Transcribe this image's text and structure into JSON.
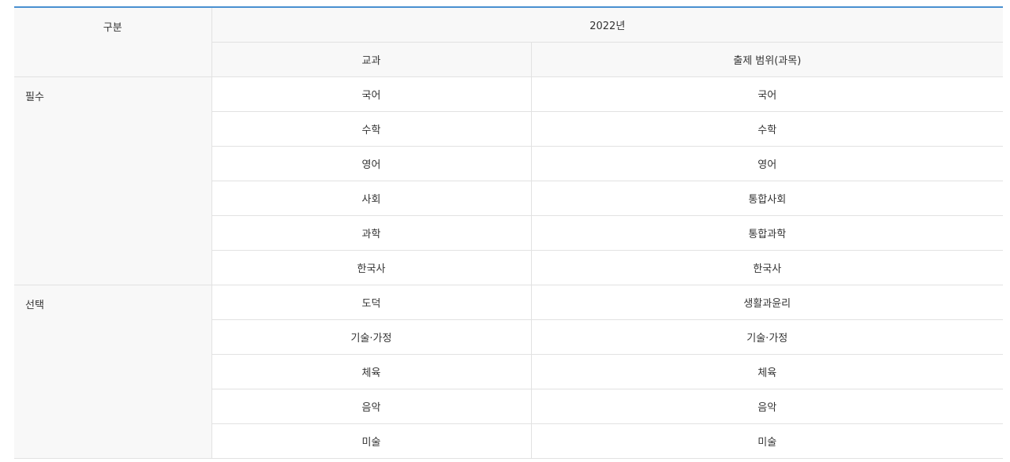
{
  "header": {
    "category_label": "구분",
    "year_label": "2022년",
    "subject_label": "교과",
    "scope_label": "출제 범위(과목)"
  },
  "groups": [
    {
      "name": "필수",
      "rows": [
        {
          "subject": "국어",
          "scope": "국어"
        },
        {
          "subject": "수학",
          "scope": "수학"
        },
        {
          "subject": "영어",
          "scope": "영어"
        },
        {
          "subject": "사회",
          "scope": "통합사회"
        },
        {
          "subject": "과학",
          "scope": "통합과학"
        },
        {
          "subject": "한국사",
          "scope": "한국사"
        }
      ]
    },
    {
      "name": "선택",
      "rows": [
        {
          "subject": "도덕",
          "scope": "생활과윤리"
        },
        {
          "subject": "기술·가정",
          "scope": "기술·가정"
        },
        {
          "subject": "체육",
          "scope": "체육"
        },
        {
          "subject": "음악",
          "scope": "음악"
        },
        {
          "subject": "미술",
          "scope": "미술"
        }
      ]
    }
  ]
}
